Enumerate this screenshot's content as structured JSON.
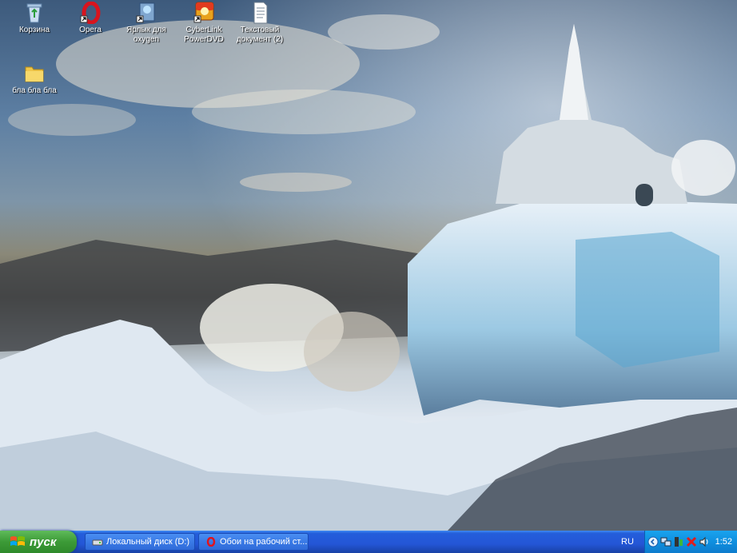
{
  "desktop": {
    "icons": [
      {
        "label": "Корзина",
        "icon": "recycle-bin-icon"
      },
      {
        "label": "Opera",
        "icon": "opera-icon"
      },
      {
        "label": "Ярлык для oxygen",
        "icon": "shortcut-icon"
      },
      {
        "label": "CyberLink PowerDVD",
        "icon": "powerdvd-icon"
      },
      {
        "label": "Текстовый документ (2)",
        "icon": "text-document-icon"
      },
      {
        "label": "бла бла бла",
        "icon": "folder-icon"
      }
    ]
  },
  "taskbar": {
    "start_label": "пуск",
    "tasks": [
      {
        "label": "Локальный диск (D:)",
        "icon": "drive-icon"
      },
      {
        "label": "Обои на рабочий ст...",
        "icon": "opera-icon"
      }
    ],
    "language": "RU",
    "clock": "1:52"
  },
  "colors": {
    "taskbar": "#245edb",
    "start": "#3c9a37",
    "tray": "#0f8fdf"
  }
}
